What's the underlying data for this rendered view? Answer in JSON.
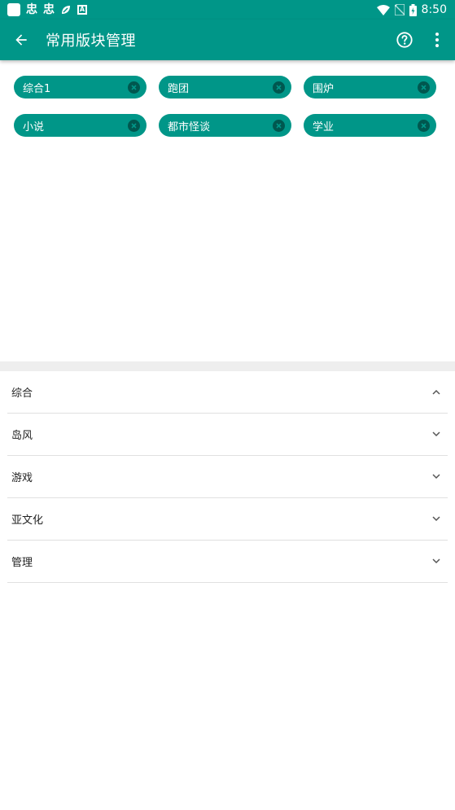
{
  "status_bar": {
    "time": "8:50",
    "left_icons": [
      "app-square-icon",
      "notify-glyph-1",
      "notify-glyph-2",
      "leaf-icon",
      "a-badge-icon"
    ],
    "right_icons": [
      "wifi-icon",
      "no-sim-icon",
      "battery-icon"
    ],
    "glyph_1": "忠",
    "glyph_2": "忠",
    "badge": "A"
  },
  "app_bar": {
    "title": "常用版块管理",
    "back_icon": "arrow-back-icon",
    "help_icon": "help-circle-icon",
    "more_icon": "more-vert-icon",
    "color": "#009688"
  },
  "chips": [
    {
      "label": "综合1"
    },
    {
      "label": "跑团"
    },
    {
      "label": "围炉"
    },
    {
      "label": "小说"
    },
    {
      "label": "都市怪谈"
    },
    {
      "label": "学业"
    }
  ],
  "groups": [
    {
      "label": "综合",
      "expanded": true
    },
    {
      "label": "岛风",
      "expanded": false
    },
    {
      "label": "游戏",
      "expanded": false
    },
    {
      "label": "亚文化",
      "expanded": false
    },
    {
      "label": "管理",
      "expanded": false
    }
  ]
}
